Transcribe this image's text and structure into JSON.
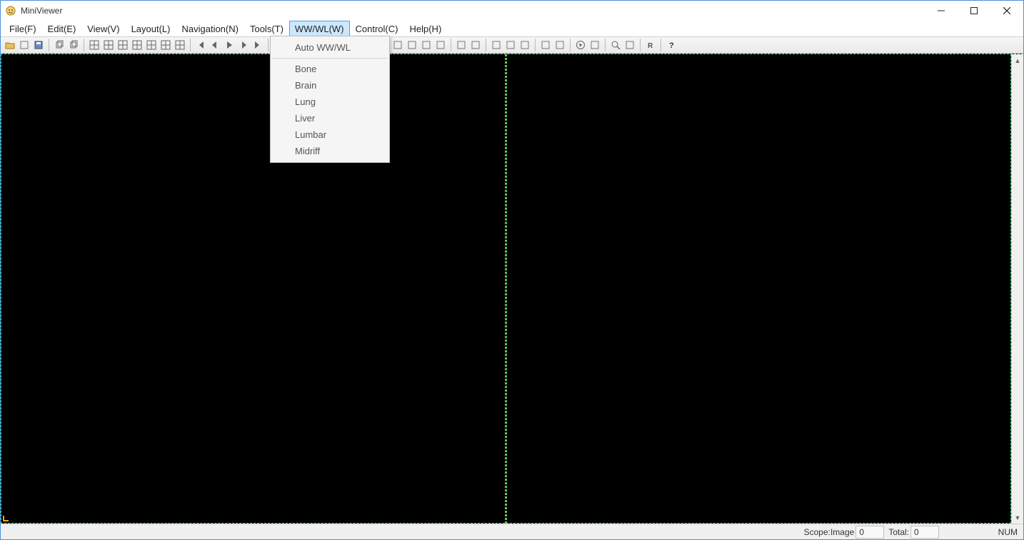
{
  "app": {
    "title": "MiniViewer"
  },
  "menu": {
    "items": [
      {
        "label": "File(F)"
      },
      {
        "label": "Edit(E)"
      },
      {
        "label": "View(V)"
      },
      {
        "label": "Layout(L)"
      },
      {
        "label": "Navigation(N)"
      },
      {
        "label": "Tools(T)"
      },
      {
        "label": "WW/WL(W)",
        "active": true
      },
      {
        "label": "Control(C)"
      },
      {
        "label": "Help(H)"
      }
    ]
  },
  "dropdown": {
    "items": [
      {
        "label": "Auto WW/WL"
      },
      {
        "sep": true
      },
      {
        "label": "Bone"
      },
      {
        "label": "Brain"
      },
      {
        "label": "Lung"
      },
      {
        "label": "Liver"
      },
      {
        "label": "Lumbar"
      },
      {
        "label": "Midriff"
      }
    ]
  },
  "toolbar": {
    "icons": [
      "open-folder-icon",
      "open-file-icon",
      "save-icon",
      "sep",
      "copy-icon",
      "paste-icon",
      "sep",
      "layout-1x1-icon",
      "layout-1x2-icon",
      "layout-2x1-icon",
      "layout-2x2-icon",
      "layout-2x3-icon",
      "layout-3x3-icon",
      "layout-4x4-icon",
      "sep",
      "nav-first-icon",
      "nav-prev-icon",
      "nav-play-icon",
      "nav-next-icon",
      "nav-last-icon",
      "sep",
      "window-fit-icon",
      "sep",
      "zoom-icon",
      "pan-icon",
      "rotate-icon",
      "sep",
      "brightness-icon",
      "contrast-icon",
      "invert-icon",
      "sep",
      "annotate-icon",
      "measure-icon",
      "angle-icon",
      "roi-icon",
      "sep",
      "tag-icon",
      "info-icon",
      "sep",
      "ruler-icon",
      "protractor-icon",
      "area-icon",
      "sep",
      "export-icon",
      "print-icon",
      "sep",
      "play-circle-icon",
      "settings-icon",
      "sep",
      "search-icon",
      "library-icon",
      "sep",
      "reset-icon",
      "sep",
      "help-icon"
    ]
  },
  "status": {
    "scope_label": "Scope:Image",
    "scope_value": "0",
    "total_label": "Total:",
    "total_value": "0",
    "num_indicator": "NUM"
  }
}
